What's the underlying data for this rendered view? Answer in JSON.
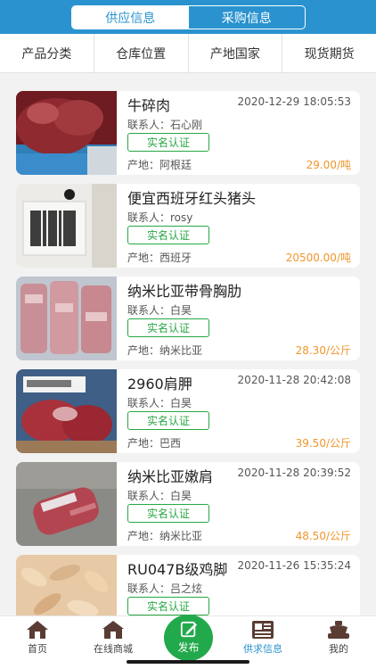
{
  "header": {
    "tabs": [
      {
        "label": "供应信息",
        "active": true
      },
      {
        "label": "采购信息",
        "active": false
      }
    ]
  },
  "filters": [
    "产品分类",
    "仓库位置",
    "产地国家",
    "现货期货"
  ],
  "listings": [
    {
      "title": "牛碎肉",
      "time": "2020-12-29 18:05:53",
      "contact": "联系人：石心刚",
      "badge": "实名认证",
      "origin": "产地：阿根廷",
      "price": "29.00/吨"
    },
    {
      "title": "便宜西班牙红头猪头",
      "time": "",
      "contact": "联系人：rosy",
      "badge": "实名认证",
      "origin": "产地：西班牙",
      "price": "20500.00/吨"
    },
    {
      "title": "纳米比亚带骨胸肋",
      "time": "",
      "contact": "联系人：白昊",
      "badge": "实名认证",
      "origin": "产地：纳米比亚",
      "price": "28.30/公斤"
    },
    {
      "title": "2960肩胛",
      "time": "2020-11-28 20:42:08",
      "contact": "联系人：白昊",
      "badge": "实名认证",
      "origin": "产地：巴西",
      "price": "39.50/公斤"
    },
    {
      "title": "纳米比亚嫩肩",
      "time": "2020-11-28 20:39:52",
      "contact": "联系人：白昊",
      "badge": "实名认证",
      "origin": "产地：纳米比亚",
      "price": "48.50/公斤"
    },
    {
      "title": "RU047B级鸡脚",
      "time": "2020-11-26 15:35:24",
      "contact": "联系人：吕之炫",
      "badge": "实名认证",
      "origin": "",
      "price": ""
    }
  ],
  "tabbar": {
    "home": "首页",
    "mall": "在线商城",
    "publish": "发布",
    "supply": "供求信息",
    "mine": "我的"
  },
  "colors": {
    "primary": "#2a93cf",
    "verified": "#28a745",
    "price": "#f0962c",
    "publish": "#22a94b"
  }
}
